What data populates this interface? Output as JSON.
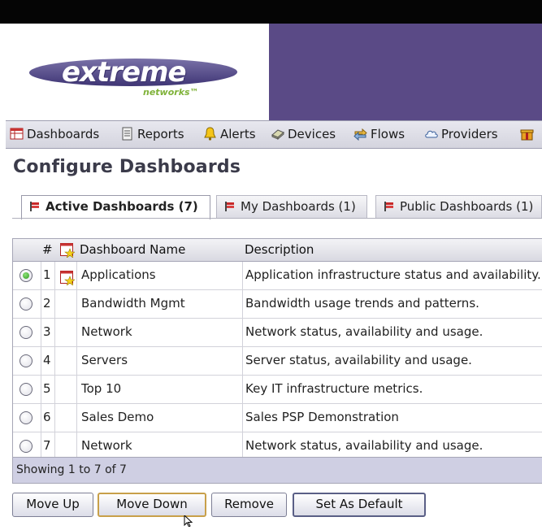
{
  "header": {
    "logo_word": "extreme",
    "logo_sub": "networks™",
    "brand_color": "#5a4a86"
  },
  "nav": {
    "items": [
      {
        "label": "Dashboards",
        "icon": "dashboard-icon"
      },
      {
        "label": "Reports",
        "icon": "report-icon"
      },
      {
        "label": "Alerts",
        "icon": "alert-bell-icon"
      },
      {
        "label": "Devices",
        "icon": "device-icon"
      },
      {
        "label": "Flows",
        "icon": "flows-icon"
      },
      {
        "label": "Providers",
        "icon": "provider-cloud-icon"
      }
    ]
  },
  "page": {
    "title": "Configure Dashboards"
  },
  "tabs": [
    {
      "label": "Active Dashboards (7)",
      "active": true
    },
    {
      "label": "My Dashboards (1)",
      "active": false
    },
    {
      "label": "Public Dashboards (1)",
      "active": false
    }
  ],
  "table": {
    "columns": {
      "num": "#",
      "name": "Dashboard Name",
      "description": "Description"
    },
    "rows": [
      {
        "selected": true,
        "num": "1",
        "default_icon": true,
        "name": "Applications",
        "description": "Application infrastructure status and availability."
      },
      {
        "selected": false,
        "num": "2",
        "default_icon": false,
        "name": "Bandwidth Mgmt",
        "description": "Bandwidth usage trends and patterns."
      },
      {
        "selected": false,
        "num": "3",
        "default_icon": false,
        "name": "Network",
        "description": "Network status, availability and usage."
      },
      {
        "selected": false,
        "num": "4",
        "default_icon": false,
        "name": "Servers",
        "description": "Server status, availability and usage."
      },
      {
        "selected": false,
        "num": "5",
        "default_icon": false,
        "name": "Top 10",
        "description": "Key IT infrastructure metrics."
      },
      {
        "selected": false,
        "num": "6",
        "default_icon": false,
        "name": "Sales Demo",
        "description": "Sales PSP Demonstration"
      },
      {
        "selected": false,
        "num": "7",
        "default_icon": false,
        "name": "Network",
        "description": "Network status, availability and usage."
      }
    ],
    "footer": "Showing 1 to 7 of 7"
  },
  "buttons": {
    "move_up": "Move Up",
    "move_down": "Move Down",
    "remove": "Remove",
    "set_default": "Set As Default"
  }
}
